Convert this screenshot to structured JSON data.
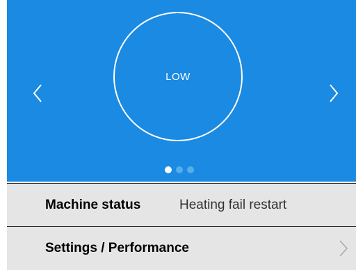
{
  "mode": {
    "label": "LOW"
  },
  "carousel": {
    "pages": 3,
    "active_page": 1
  },
  "status_row": {
    "label": "Machine status",
    "value": "Heating fail restart"
  },
  "settings_row": {
    "label": "Settings / Performance"
  },
  "icons": {
    "prev": "chevron-left-icon",
    "next": "chevron-right-icon",
    "settings_chevron": "chevron-right-icon"
  },
  "colors": {
    "hero_background": "#1a8ae2",
    "row_background": "#e5e5e5",
    "dot_active": "#ffffff",
    "dot_inactive": "#56aee9"
  }
}
